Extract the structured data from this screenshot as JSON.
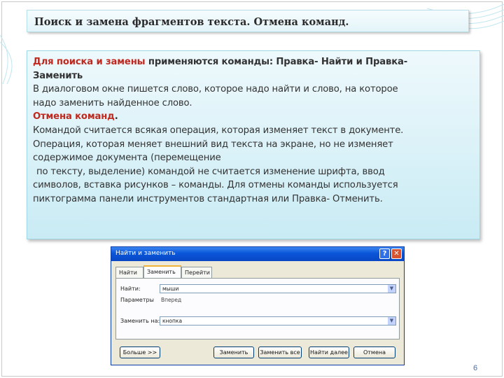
{
  "slide": {
    "title": "Поиск и замена фрагментов текста. Отмена команд.",
    "page_number": "6",
    "body": {
      "l1_red": "Для поиска и замены",
      "l1_bold": " применяются команды",
      "l1_rest": ": Правка- Найти и Правка-",
      "l2": "Заменить",
      "l3": "В диалоговом окне пишется слово, которое надо найти и слово, на которое",
      "l4": "надо заменить найденное слово.",
      "l5_red": "Отмена команд",
      "l5_dot": ".",
      "l6": "Командой считается всякая операция, которая изменяет текст в документе.",
      "l7": "Операция, которая меняет внешний вид текста на экране, но не изменяет",
      "l8": "содержимое документа (перемещение",
      "l9": "по тексту, выделение) командой не считается изменение шрифта, ввод",
      "l10": "символов, вставка рисунков – команды. Для отмены команды используется",
      "l11": "пиктограмма панели инструментов стандартная или Правка- Отменить."
    }
  },
  "dialog": {
    "title": "Найти и заменить",
    "help_glyph": "?",
    "close_glyph": "✕",
    "tabs": [
      "Найти",
      "Заменить",
      "Перейти"
    ],
    "find_label": "Найти:",
    "find_value": "мыши",
    "params_label": "Параметры",
    "params_value": "Вперед",
    "replace_label": "Заменить на:",
    "replace_value": "кнопка",
    "dropdown_glyph": "▼",
    "buttons": {
      "more": "Больше >>",
      "replace": "Заменить",
      "replace_all": "Заменить все",
      "find_next": "Найти далее",
      "cancel": "Отмена"
    }
  },
  "colors": {
    "accent_red": "#c0291f",
    "body_bg": "#c9ebf4",
    "titlebar_blue": "#0a55d8"
  }
}
